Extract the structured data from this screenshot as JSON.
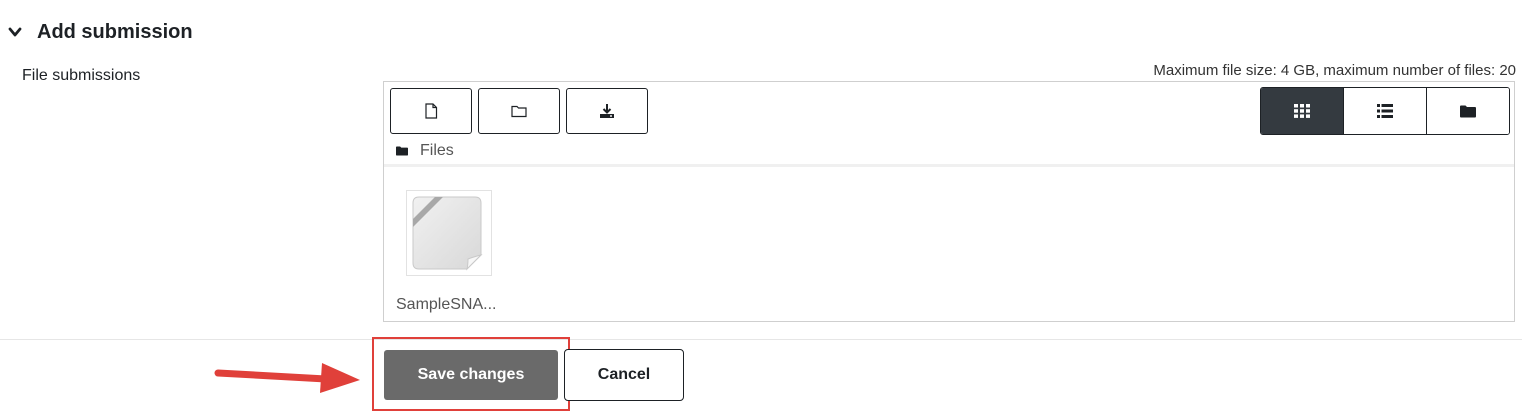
{
  "section": {
    "title": "Add submission",
    "icon": "chevron-down-icon"
  },
  "field": {
    "label": "File submissions"
  },
  "filepicker": {
    "limits": "Maximum file size: 4 GB, maximum number of files: 20",
    "toolbar": [
      {
        "name": "add-file-button",
        "icon": "file-icon"
      },
      {
        "name": "create-folder-button",
        "icon": "folder-icon"
      },
      {
        "name": "download-button",
        "icon": "download-icon"
      }
    ],
    "views": [
      {
        "name": "icons-view",
        "icon": "grid-icon",
        "active": true
      },
      {
        "name": "details-view",
        "icon": "list-icon",
        "active": false
      },
      {
        "name": "tree-view",
        "icon": "folder-filled-icon",
        "active": false
      }
    ],
    "path": {
      "label": "Files",
      "icon": "folder-filled-icon"
    },
    "files": [
      {
        "name": "SampleSNA..."
      }
    ]
  },
  "actions": {
    "save": "Save changes",
    "cancel": "Cancel"
  },
  "colors": {
    "highlight": "#e0403a",
    "save_bg": "#6a6a6a",
    "active_view_bg": "#343a40"
  }
}
